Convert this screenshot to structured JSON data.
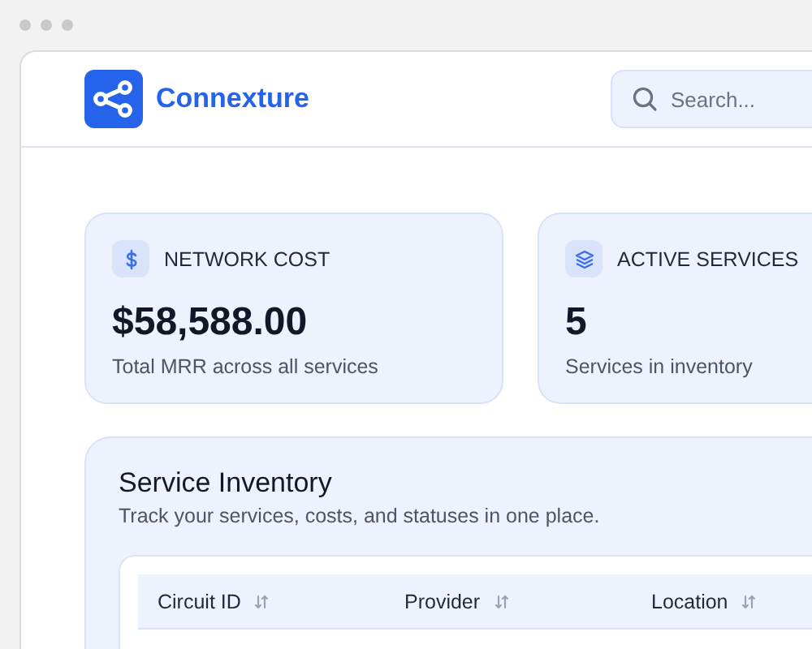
{
  "app": {
    "name": "Connexture"
  },
  "search": {
    "placeholder": "Search..."
  },
  "stats": [
    {
      "kind": "cost",
      "label": "NETWORK COST",
      "value": "$58,588.00",
      "caption": "Total MRR across all services"
    },
    {
      "kind": "services",
      "label": "ACTIVE SERVICES",
      "value": "5",
      "caption": "Services in inventory"
    }
  ],
  "inventory": {
    "title": "Service Inventory",
    "subtitle": "Track your services, costs, and statuses in one place.",
    "table": {
      "columns": [
        {
          "label": "Circuit ID"
        },
        {
          "label": "Provider"
        },
        {
          "label": "Location"
        }
      ]
    }
  }
}
